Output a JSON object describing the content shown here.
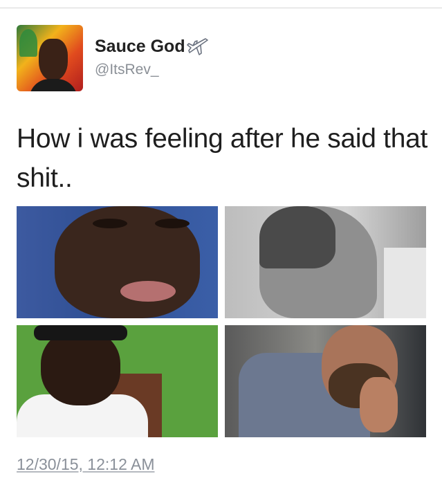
{
  "tweet": {
    "display_name": "Sauce God",
    "name_emoji_icon": "airplane-icon",
    "handle": "@ItsRev_",
    "text": "How i was feeling after he said that shit..",
    "timestamp": "12/30/15, 12:12 AM",
    "media_count": 4
  },
  "colors": {
    "text": "#1e1e1e",
    "secondary": "#8a8f96",
    "divider": "#d6d6d6"
  }
}
